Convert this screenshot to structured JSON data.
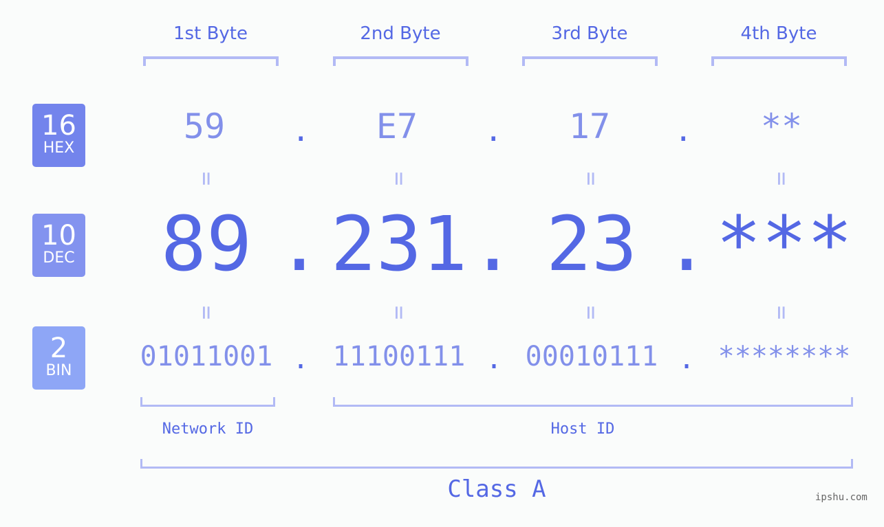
{
  "byte_headers": [
    "1st Byte",
    "2nd Byte",
    "3rd Byte",
    "4th Byte"
  ],
  "bases": [
    {
      "num": "16",
      "label": "HEX",
      "color": "#7384ec"
    },
    {
      "num": "10",
      "label": "DEC",
      "color": "#8393ef"
    },
    {
      "num": "2",
      "label": "BIN",
      "color": "#8ea6f6"
    }
  ],
  "hex": [
    "59",
    "E7",
    "17",
    "**"
  ],
  "dec": [
    "89",
    "231",
    "23",
    "***"
  ],
  "bin": [
    "01011001",
    "11100111",
    "00010111",
    "********"
  ],
  "separator": ".",
  "equals": "=",
  "network_label": "Network ID",
  "host_label": "Host ID",
  "class_label": "Class A",
  "watermark": "ipshu.com"
}
